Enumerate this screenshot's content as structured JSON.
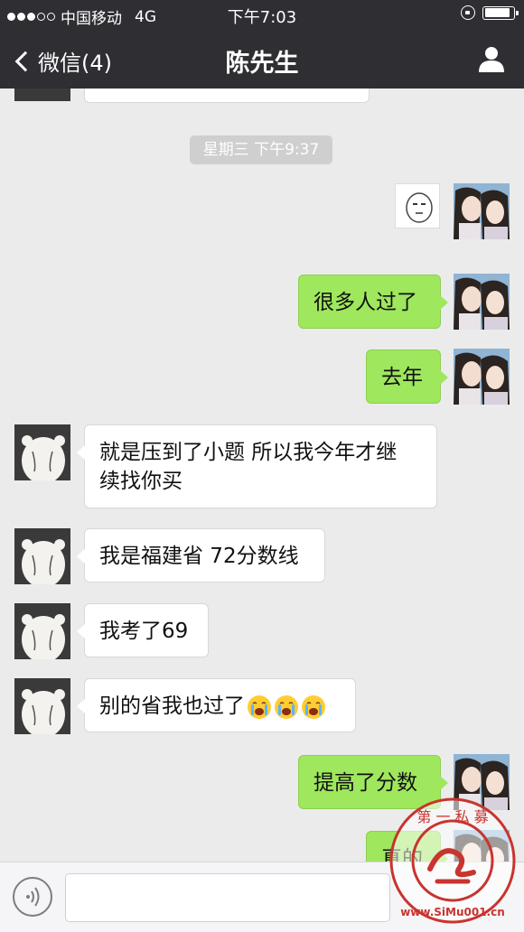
{
  "status_bar": {
    "carrier": "中国移动",
    "network": "4G",
    "time": "下午7:03"
  },
  "nav": {
    "back_label": "微信(4)",
    "title": "陈先生"
  },
  "chat": {
    "timestamp": "星期三 下午9:37",
    "messages": [
      {
        "side": "out",
        "type": "sticker"
      },
      {
        "side": "out",
        "text": "很多人过了"
      },
      {
        "side": "out",
        "text": "去年"
      },
      {
        "side": "in",
        "text_line1": "就是压到了小题 所以我今年才继",
        "text_line2": "续找你买"
      },
      {
        "side": "in",
        "text": "我是福建省 72分数线"
      },
      {
        "side": "in",
        "text": "我考了69"
      },
      {
        "side": "in",
        "text": "别的省我也过了"
      },
      {
        "side": "out",
        "text": "提高了分数"
      },
      {
        "side": "out",
        "text": "真的"
      }
    ]
  },
  "watermark": {
    "top_text": "第 一 私 募",
    "bottom_text": "www.SiMu001.cn"
  },
  "colors": {
    "nav_bg": "#2e2e33",
    "chat_bg": "#ebebeb",
    "outgoing_bubble": "#9fe75d",
    "incoming_bubble": "#ffffff",
    "watermark_red": "#c8342f"
  },
  "icons": [
    "back-chevron-icon",
    "person-icon",
    "voice-icon",
    "lock-rotation-icon",
    "battery-icon",
    "crying-emoji-icon"
  ]
}
